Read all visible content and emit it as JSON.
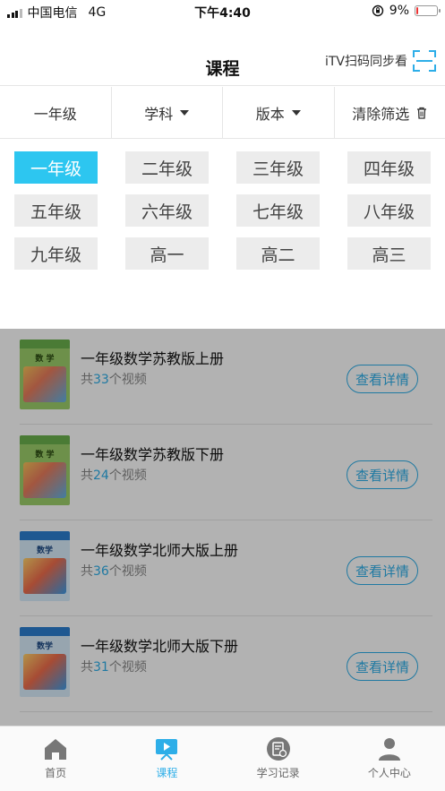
{
  "status_bar": {
    "carrier": "中国电信",
    "network": "4G",
    "time": "下午4:40",
    "battery": "9%",
    "battery_level": 0.09
  },
  "header": {
    "title": "课程",
    "scan_label": "iTV扫码同步看"
  },
  "filters": {
    "grade": "一年级",
    "subject": "学科",
    "edition": "版本",
    "clear": "清除筛选"
  },
  "grades": [
    {
      "label": "一年级",
      "selected": true
    },
    {
      "label": "二年级",
      "selected": false
    },
    {
      "label": "三年级",
      "selected": false
    },
    {
      "label": "四年级",
      "selected": false
    },
    {
      "label": "五年级",
      "selected": false
    },
    {
      "label": "六年级",
      "selected": false
    },
    {
      "label": "七年级",
      "selected": false
    },
    {
      "label": "八年级",
      "selected": false
    },
    {
      "label": "九年级",
      "selected": false
    },
    {
      "label": "高一",
      "selected": false
    },
    {
      "label": "高二",
      "selected": false
    },
    {
      "label": "高三",
      "selected": false
    }
  ],
  "courses": [
    {
      "name": "一年级数学苏教版上册",
      "count_prefix": "共",
      "count": "33",
      "count_suffix": "个视频",
      "button": "查看详情",
      "cover_text": "数 学"
    },
    {
      "name": "一年级数学苏教版下册",
      "count_prefix": "共",
      "count": "24",
      "count_suffix": "个视频",
      "button": "查看详情",
      "cover_text": "数 学"
    },
    {
      "name": "一年级数学北师大版上册",
      "count_prefix": "共",
      "count": "36",
      "count_suffix": "个视频",
      "button": "查看详情",
      "cover_text": "数学"
    },
    {
      "name": "一年级数学北师大版下册",
      "count_prefix": "共",
      "count": "31",
      "count_suffix": "个视频",
      "button": "查看详情",
      "cover_text": "数学"
    }
  ],
  "tabs": [
    {
      "label": "首页",
      "icon": "home-icon",
      "active": false
    },
    {
      "label": "课程",
      "icon": "video-icon",
      "active": true
    },
    {
      "label": "学习记录",
      "icon": "record-icon",
      "active": false
    },
    {
      "label": "个人中心",
      "icon": "person-icon",
      "active": false
    }
  ],
  "colors": {
    "accent": "#2dc6f0",
    "link": "#2daee8",
    "battery_low": "#ee3333"
  }
}
